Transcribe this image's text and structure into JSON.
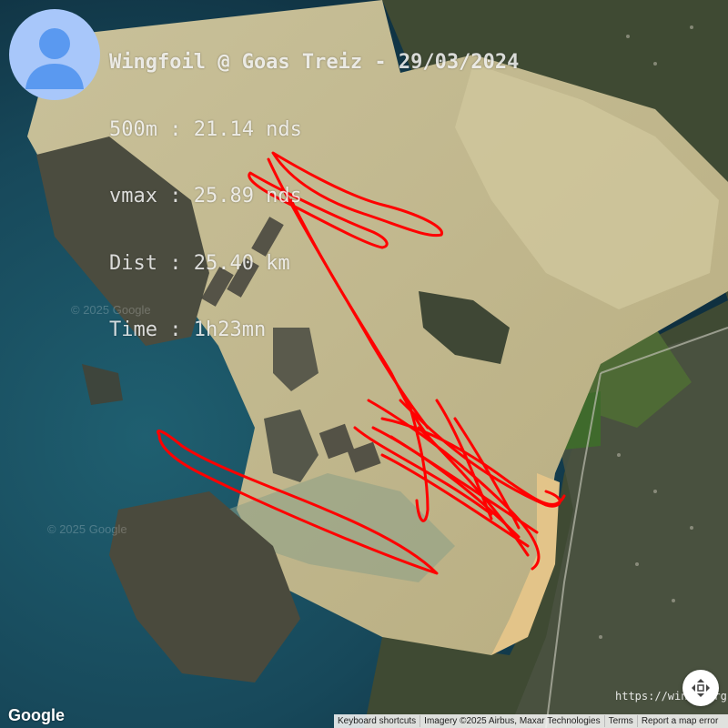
{
  "activity": {
    "title": "Wingfoil @ Goas Treiz - 29/03/2024",
    "stats": [
      "500m : 21.14 nds",
      "vmax : 25.89 nds",
      "Dist : 25.40 km",
      "Time : 1h23mn"
    ]
  },
  "map": {
    "watermarks": [
      "© 2025 Google",
      "© 2025 Google"
    ],
    "logo": "Google",
    "footer": {
      "keyboard_shortcuts": "Keyboard shortcuts",
      "imagery": "Imagery ©2025 Airbus, Maxar Technologies",
      "terms": "Terms",
      "report": "Report a map error"
    },
    "source_url": "https://windr.org",
    "track_color": "#ff0000"
  },
  "icons": {
    "avatar": "user-avatar-icon",
    "map_button": "crosshair-move-icon"
  }
}
